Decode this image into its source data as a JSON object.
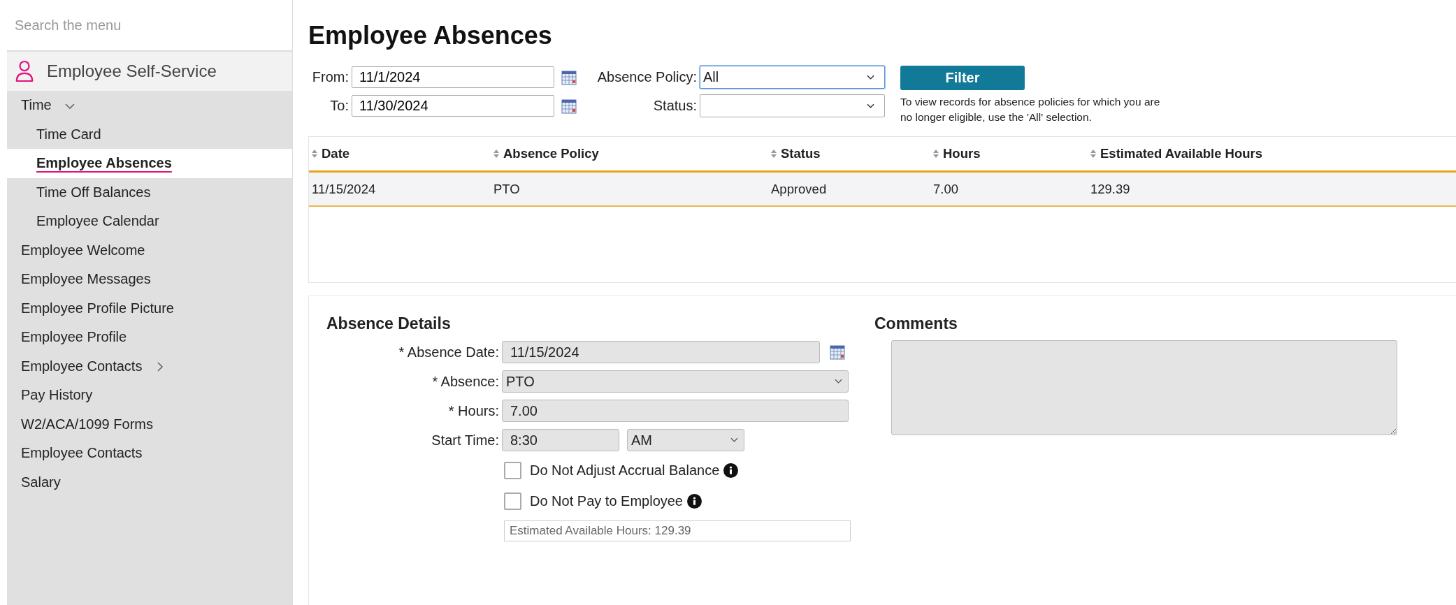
{
  "sidebar": {
    "search_placeholder": "Search the menu",
    "section": "Employee Self-Service",
    "items": [
      {
        "label": "Time",
        "expanded": true,
        "selected": false,
        "children": [
          {
            "label": "Time Card",
            "selected": false
          },
          {
            "label": "Employee Absences",
            "selected": true
          },
          {
            "label": "Time Off Balances",
            "selected": false
          },
          {
            "label": "Employee Calendar",
            "selected": false
          }
        ]
      },
      {
        "label": "Employee Welcome",
        "selected": false
      },
      {
        "label": "Employee Messages",
        "selected": false
      },
      {
        "label": "Employee Profile Picture",
        "selected": false
      },
      {
        "label": "Employee Profile",
        "selected": false
      },
      {
        "label": "Employee Contacts",
        "expanded": false,
        "selected": false
      },
      {
        "label": "Pay History",
        "selected": false
      },
      {
        "label": "W2/ACA/1099 Forms",
        "selected": false
      },
      {
        "label": "Employee Contacts",
        "selected": false
      },
      {
        "label": "Salary",
        "selected": false
      }
    ]
  },
  "page": {
    "title": "Employee Absences"
  },
  "filters": {
    "from": {
      "label": "From:",
      "value": "11/1/2024"
    },
    "to": {
      "label": "To:",
      "value": "11/30/2024"
    },
    "absence_policy": {
      "label": "Absence Policy:",
      "value": "All",
      "focused": true
    },
    "status": {
      "label": "Status:",
      "focused": false
    },
    "filter_button": "Filter",
    "hint": "To view records for absence policies for which you are no longer eligible, use the 'All' selection."
  },
  "table": {
    "columns": [
      "Date",
      "Absence Policy",
      "Status",
      "Hours",
      "Estimated Available Hours"
    ],
    "rows": [
      {
        "cells": [
          "11/15/2024",
          "PTO",
          "Approved",
          "7.00",
          "129.39"
        ]
      }
    ]
  },
  "details": {
    "title": "Absence Details",
    "absence_date": {
      "label": "* Absence Date:",
      "value": "11/15/2024"
    },
    "absence": {
      "label": "* Absence:",
      "value": "PTO"
    },
    "hours": {
      "label": "* Hours:",
      "value": "7.00"
    },
    "start_time": {
      "label": "Start Time:",
      "value": "8:30",
      "period": "AM"
    },
    "options": [
      {
        "label": "Do Not Adjust Accrual Balance",
        "checked": false
      },
      {
        "label": "Do Not Pay to Employee",
        "checked": false
      }
    ],
    "estimate": "Estimated Available Hours: 129.39"
  },
  "comments": {
    "title": "Comments"
  }
}
